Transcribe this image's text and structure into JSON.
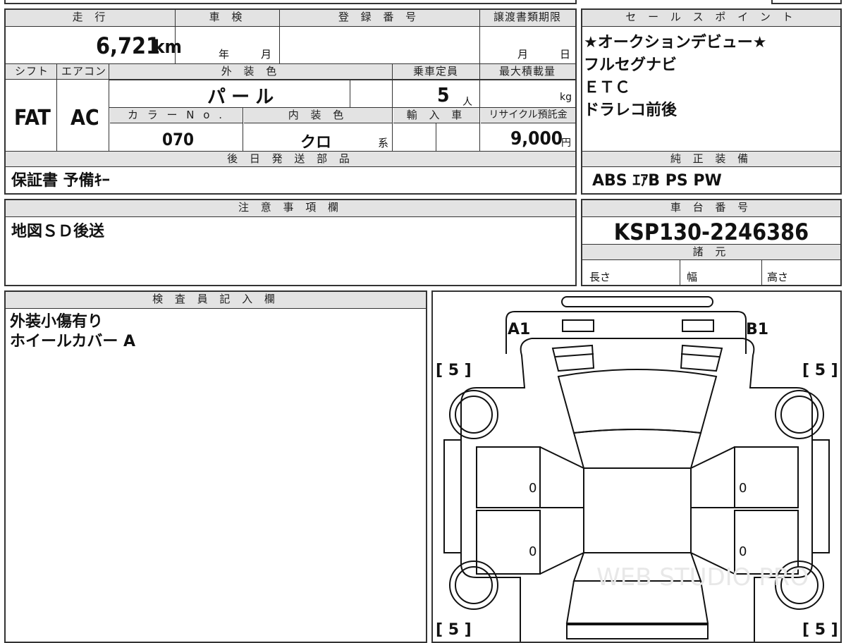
{
  "mileage": {
    "header": "走 行",
    "value": "6,721",
    "unit": "km"
  },
  "inspection": {
    "header": "車 検",
    "year_unit": "年",
    "month_unit": "月"
  },
  "registration": {
    "header": "登 録 番 号"
  },
  "transfer_deadline": {
    "header": "譲渡書類期限",
    "month_unit": "月",
    "day_unit": "日"
  },
  "shift": {
    "header": "シフト",
    "value": "FAT"
  },
  "aircon": {
    "header": "エアコン",
    "value": "AC"
  },
  "exterior_color": {
    "header": "外 装 色",
    "value": "パ ー ル"
  },
  "capacity": {
    "header": "乗車定員",
    "value": "5",
    "unit": "人"
  },
  "max_load": {
    "header": "最大積載量",
    "unit": "kg"
  },
  "color_no": {
    "header": "カ ラ ー N o .",
    "value": "070"
  },
  "interior_color": {
    "header": "内 装 色",
    "value": "クロ",
    "suffix": "系"
  },
  "import": {
    "header": "輸 入 車"
  },
  "recycle": {
    "header": "リサイクル預託金",
    "value": "9,000",
    "unit": "円"
  },
  "later_parts": {
    "header": "後 日 発 送 部 品",
    "value": "保証書 予備ｷｰ"
  },
  "sales_points": {
    "header": "セ ー ル ス ポ イ ン ト",
    "items": [
      "★オークションデビュー★",
      "フルセグナビ",
      "ＥＴＣ",
      "ドラレコ前後"
    ]
  },
  "standard_equipment": {
    "header": "純 正 装 備",
    "value": "ABS ｴｱB PS PW"
  },
  "notes": {
    "header": "注 意 事 項 欄",
    "value": "地図ＳＤ後送"
  },
  "chassis": {
    "header": "車 台 番 号",
    "value": "KSP130-2246386"
  },
  "specs": {
    "header": "諸 元",
    "length": "長さ",
    "width": "幅",
    "height": "高さ"
  },
  "inspector": {
    "header": "検 査 員 記 入 欄",
    "lines": [
      "外装小傷有り",
      "ホイールカバー A"
    ]
  },
  "diagram": {
    "mark_front_left": "A1",
    "mark_front_right": "B1",
    "tire_fl": "[ 5 ]",
    "tire_fr": "[ 5 ]",
    "tire_rl": "[ 5 ]",
    "tire_rr": "[ 5 ]",
    "door_fl": "0",
    "door_rl": "0",
    "door_fr": "0",
    "door_rr": "0",
    "watermark": "WEB STUDIO PRO"
  }
}
